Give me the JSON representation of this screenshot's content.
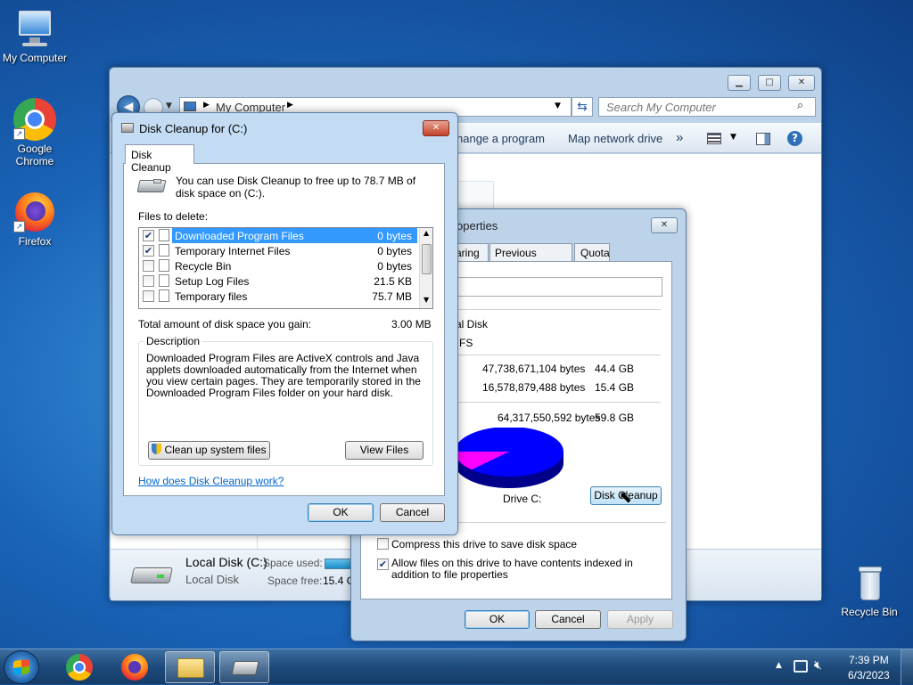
{
  "desktop": {
    "icons": [
      {
        "label": "My Computer"
      },
      {
        "label": "Google Chrome"
      },
      {
        "label": "Firefox"
      },
      {
        "label": "Recycle Bin"
      }
    ]
  },
  "explorer": {
    "address": "My Computer",
    "search_placeholder": "Search My Computer",
    "toolbar": {
      "uninstall": "hange a program",
      "map_drive": "Map network drive",
      "more": "»"
    },
    "details": {
      "name": "Local Disk (C:)",
      "type": "Local Disk",
      "space_used_label": "Space used:",
      "space_free_label": "Space free:",
      "space_free_value": "15.4 G"
    }
  },
  "properties": {
    "title": "operties",
    "tabs": [
      "aring",
      "Previous Versions",
      "Quota"
    ],
    "type_value": "al Disk",
    "fs_value": "FS",
    "used_bytes": "47,738,671,104 bytes",
    "used_gb": "44.4 GB",
    "free_bytes": "16,578,879,488 bytes",
    "free_gb": "15.4 GB",
    "capacity_bytes": "64,317,550,592 bytes",
    "capacity_gb": "59.8 GB",
    "drive_label": "Drive C:",
    "disk_cleanup_button": "Disk Cleanup",
    "compress_label": "Compress this drive to save disk space",
    "index_label": "Allow files on this drive to have contents indexed in addition to file properties",
    "ok": "OK",
    "cancel": "Cancel",
    "apply": "Apply",
    "usage": {
      "used_fraction": 0.742,
      "used_color": "#ff00ff",
      "free_color": "#0000ff"
    }
  },
  "cleanup": {
    "title": "Disk Cleanup for  (C:)",
    "tab": "Disk Cleanup",
    "intro": "You can use Disk Cleanup to free up to 78.7 MB of disk space on  (C:).",
    "files_label": "Files to delete:",
    "files": [
      {
        "name": "Downloaded Program Files",
        "size": "0 bytes",
        "checked": true,
        "selected": true
      },
      {
        "name": "Temporary Internet Files",
        "size": "0 bytes",
        "checked": true,
        "selected": false
      },
      {
        "name": "Recycle Bin",
        "size": "0 bytes",
        "checked": false,
        "selected": false
      },
      {
        "name": "Setup Log Files",
        "size": "21.5 KB",
        "checked": false,
        "selected": false
      },
      {
        "name": "Temporary files",
        "size": "75.7 MB",
        "checked": false,
        "selected": false
      }
    ],
    "total_label": "Total amount of disk space you gain:",
    "total_value": "3.00 MB",
    "description_title": "Description",
    "description": "Downloaded Program Files are ActiveX controls and Java applets downloaded automatically from the Internet when you view certain pages. They are temporarily stored in the Downloaded Program Files folder on your hard disk.",
    "cleanup_system_button": "Clean up system files",
    "view_files_button": "View Files",
    "help_link": "How does Disk Cleanup work?",
    "ok": "OK",
    "cancel": "Cancel"
  },
  "taskbar": {
    "time": "7:39 PM",
    "date": "6/3/2023"
  }
}
